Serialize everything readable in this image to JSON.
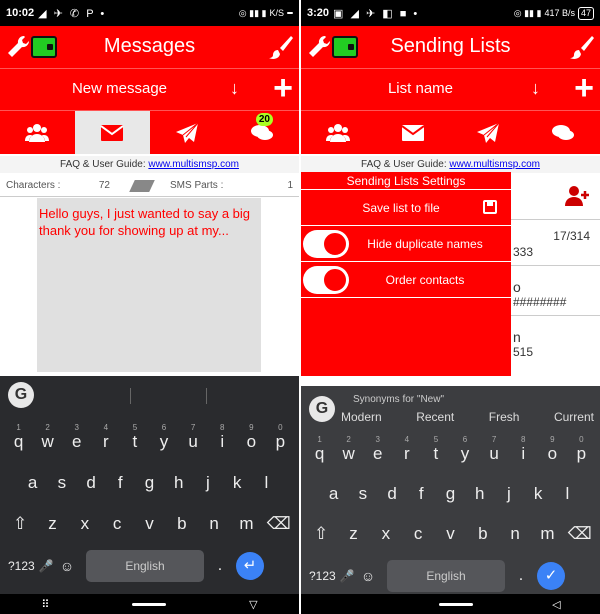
{
  "left": {
    "status": {
      "time": "10:02",
      "left_icons": "◢ ✈ ✆ P •",
      "right_icons": "◎ ▮▮ ▮",
      "net": "K/S",
      "battery": ""
    },
    "header": {
      "title": "Messages"
    },
    "subbar": {
      "text": "New message",
      "arrow": "↓",
      "plus": "+"
    },
    "tabs": {
      "badge": "20"
    },
    "faq": {
      "prefix": "FAQ & User Guide: ",
      "link": "www.multismsp.com"
    },
    "counter": {
      "characters_label": "Characters :",
      "characters_value": "72",
      "parts_label": "SMS Parts :",
      "parts_value": "1"
    },
    "message": {
      "text": "Hello guys, I just wanted to say a big thank you for showing up at my..."
    },
    "keyboard": {
      "logo": "G",
      "row1": [
        "q",
        "w",
        "e",
        "r",
        "t",
        "y",
        "u",
        "i",
        "o",
        "p"
      ],
      "row1_nums": [
        "1",
        "2",
        "3",
        "4",
        "5",
        "6",
        "7",
        "8",
        "9",
        "0"
      ],
      "row2": [
        "a",
        "s",
        "d",
        "f",
        "g",
        "h",
        "j",
        "k",
        "l"
      ],
      "row3": [
        "⇧",
        "z",
        "x",
        "c",
        "v",
        "b",
        "n",
        "m",
        "⌫"
      ],
      "sym": "?123",
      "mic": "🎤",
      "emoji": "☺",
      "space": "English",
      "dot": ".",
      "enter": "↵"
    },
    "nav": {
      "keyboard_icon": "⠿",
      "back": "▽"
    }
  },
  "right": {
    "status": {
      "time": "3:20",
      "left_icons": "▣ ◢ ✈ ◧ ■ •",
      "right_icons": "◎ ▮▮ ▮",
      "net": "417 B/s",
      "battery": "47"
    },
    "header": {
      "title": "Sending Lists"
    },
    "subbar": {
      "text": "List name",
      "arrow": "↓",
      "plus": "+"
    },
    "faq": {
      "prefix": "FAQ & User Guide: ",
      "link": "www.multismsp.com"
    },
    "background_list": {
      "count": "17/314",
      "row1": "333",
      "row2": "o",
      "row3": "########",
      "row4": "n",
      "row5": "515"
    },
    "settings": {
      "title": "Sending Lists Settings",
      "save": "Save list to file",
      "hide_duplicates": "Hide duplicate names",
      "order_contacts": "Order contacts"
    },
    "keyboard": {
      "logo": "G",
      "synonyms_title": "Synonyms for \"New\"",
      "synonyms": [
        "Modern",
        "Recent",
        "Fresh",
        "Current"
      ],
      "row1": [
        "q",
        "w",
        "e",
        "r",
        "t",
        "y",
        "u",
        "i",
        "o",
        "p"
      ],
      "row1_nums": [
        "1",
        "2",
        "3",
        "4",
        "5",
        "6",
        "7",
        "8",
        "9",
        "0"
      ],
      "row2": [
        "a",
        "s",
        "d",
        "f",
        "g",
        "h",
        "j",
        "k",
        "l"
      ],
      "row3": [
        "⇧",
        "z",
        "x",
        "c",
        "v",
        "b",
        "n",
        "m",
        "⌫"
      ],
      "sym": "?123",
      "mic": "🎤",
      "emoji": "☺",
      "space": "English",
      "dot": ".",
      "enter": "✓"
    },
    "nav": {
      "back": "◁"
    }
  },
  "colors": {
    "accent": "#ff0000",
    "keyboard_dark": "#2a2b2e",
    "keyboard_grey": "#3c3d40",
    "badge": "#aaff22",
    "enter_blue": "#3b82f6"
  }
}
